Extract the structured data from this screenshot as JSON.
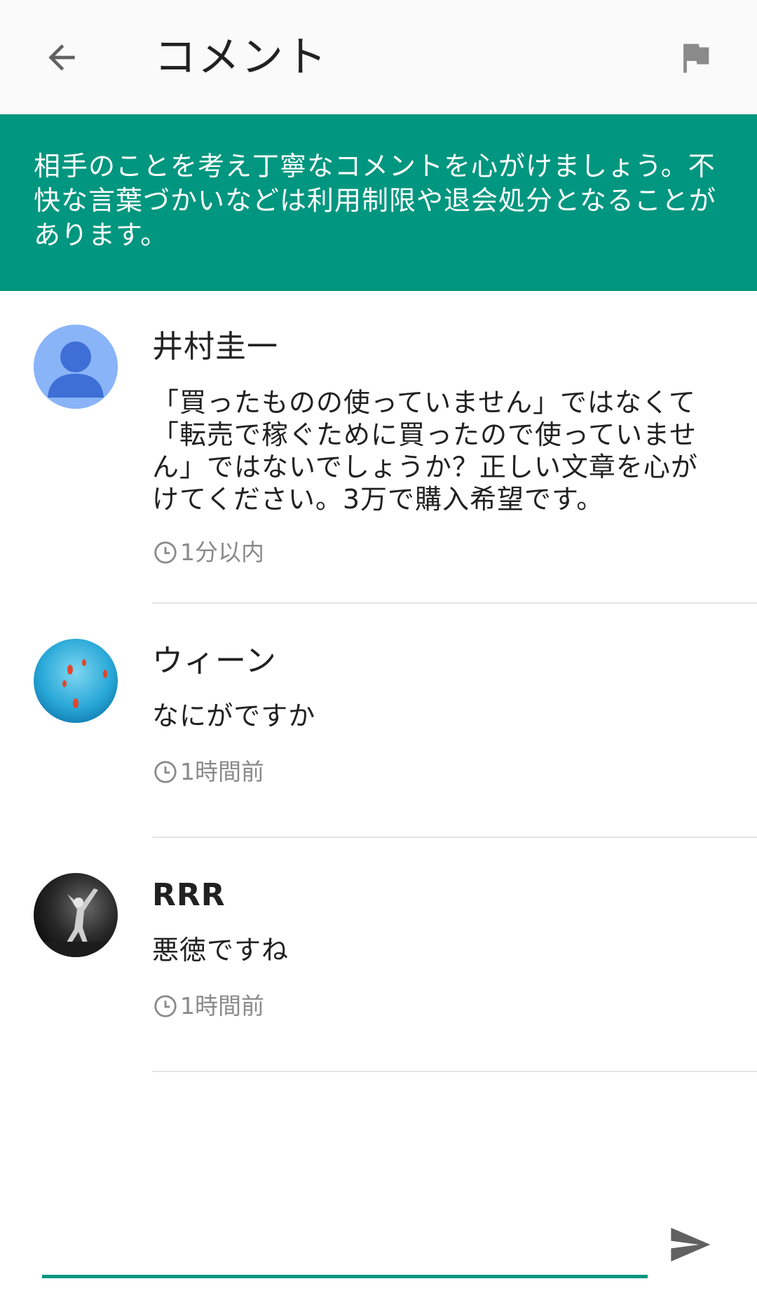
{
  "header": {
    "title": "コメント",
    "back_icon": "arrow-back-icon",
    "report_icon": "flag-icon"
  },
  "notice": {
    "text": "相手のことを考え丁寧なコメントを心がけましょう。不快な言葉づかいなどは利用制限や退会処分となることがあります。",
    "background": "#00967f"
  },
  "comments": [
    {
      "name": "井村圭一",
      "body": "「買ったものの使っていません」ではなくて「転売で稼ぐために買ったので使っていません」ではないでしょうか？正しい文章を心がけてください。3万で購入希望です。",
      "time": "1分以内",
      "avatar": "default-person-avatar"
    },
    {
      "name": "ウィーン",
      "body": "なにがですか",
      "time": "1時間前",
      "avatar": "fish-photo-avatar"
    },
    {
      "name": "RRR",
      "body": "悪徳ですね",
      "time": "1時間前",
      "avatar": "performer-photo-avatar"
    }
  ],
  "composer": {
    "value": "",
    "send_icon": "send-icon",
    "accent": "#00967f"
  }
}
